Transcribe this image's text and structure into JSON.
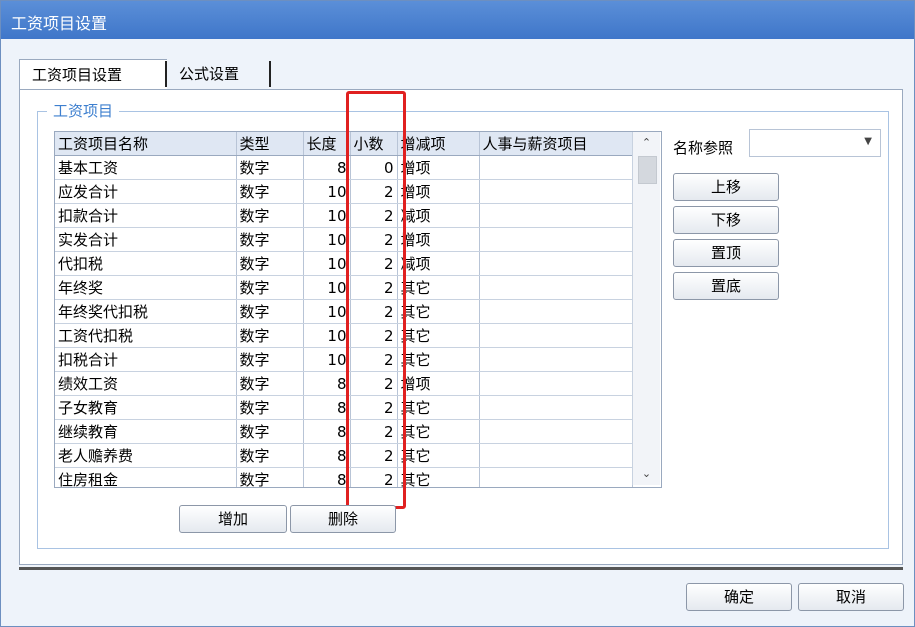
{
  "window": {
    "title": "工资项目设置"
  },
  "tabs": [
    {
      "label": "工资项目设置"
    },
    {
      "label": "公式设置"
    }
  ],
  "group": {
    "title": "工资项目"
  },
  "columns": [
    "工资项目名称",
    "类型",
    "长度",
    "小数",
    "增减项",
    "人事与薪资项目"
  ],
  "rows": [
    {
      "name": "基本工资",
      "type": "数字",
      "length": "8",
      "decimal": "0",
      "change": "增项",
      "hr": ""
    },
    {
      "name": "应发合计",
      "type": "数字",
      "length": "10",
      "decimal": "2",
      "change": "增项",
      "hr": ""
    },
    {
      "name": "扣款合计",
      "type": "数字",
      "length": "10",
      "decimal": "2",
      "change": "减项",
      "hr": ""
    },
    {
      "name": "实发合计",
      "type": "数字",
      "length": "10",
      "decimal": "2",
      "change": "增项",
      "hr": ""
    },
    {
      "name": "代扣税",
      "type": "数字",
      "length": "10",
      "decimal": "2",
      "change": "减项",
      "hr": ""
    },
    {
      "name": "年终奖",
      "type": "数字",
      "length": "10",
      "decimal": "2",
      "change": "其它",
      "hr": ""
    },
    {
      "name": "年终奖代扣税",
      "type": "数字",
      "length": "10",
      "decimal": "2",
      "change": "其它",
      "hr": ""
    },
    {
      "name": "工资代扣税",
      "type": "数字",
      "length": "10",
      "decimal": "2",
      "change": "其它",
      "hr": ""
    },
    {
      "name": "扣税合计",
      "type": "数字",
      "length": "10",
      "decimal": "2",
      "change": "其它",
      "hr": ""
    },
    {
      "name": "绩效工资",
      "type": "数字",
      "length": "8",
      "decimal": "2",
      "change": "增项",
      "hr": ""
    },
    {
      "name": "子女教育",
      "type": "数字",
      "length": "8",
      "decimal": "2",
      "change": "其它",
      "hr": ""
    },
    {
      "name": "继续教育",
      "type": "数字",
      "length": "8",
      "decimal": "2",
      "change": "其它",
      "hr": ""
    },
    {
      "name": "老人赡养费",
      "type": "数字",
      "length": "8",
      "decimal": "2",
      "change": "其它",
      "hr": ""
    },
    {
      "name": "住房租金",
      "type": "数字",
      "length": "8",
      "decimal": "2",
      "change": "其它",
      "hr": ""
    }
  ],
  "side": {
    "ref_label": "名称参照",
    "ref_value": "",
    "up": "上移",
    "down": "下移",
    "top": "置顶",
    "bottom": "置底"
  },
  "grid_buttons": {
    "add": "增加",
    "delete": "删除"
  },
  "footer": {
    "ok": "确定",
    "cancel": "取消"
  },
  "icons": {
    "scroll_up": "chevron-up-icon",
    "scroll_down": "chevron-down-icon",
    "dropdown": "triangle-down-icon"
  },
  "colors": {
    "titlebar": "#4a82d2",
    "group_title": "#3d7fcf",
    "highlight_box": "#e02020"
  }
}
